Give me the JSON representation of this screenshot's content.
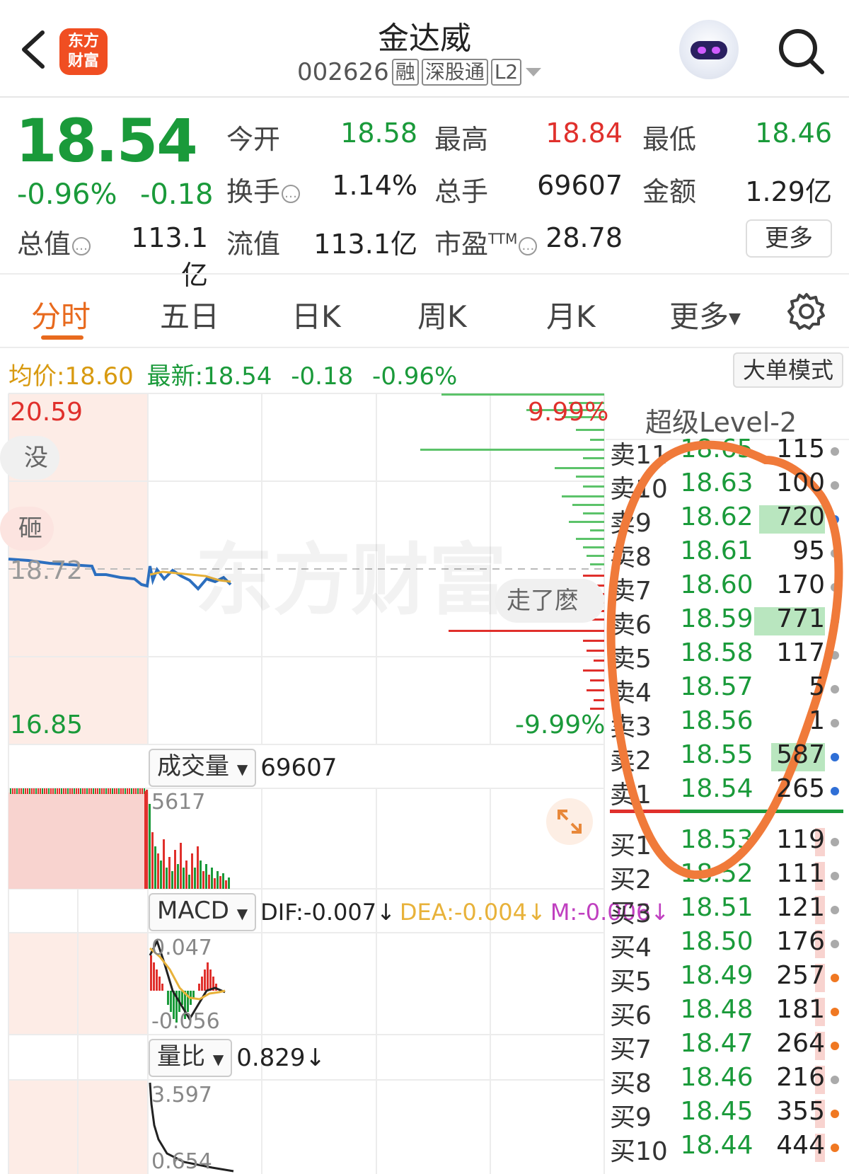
{
  "header": {
    "title": "金达威",
    "code": "002626",
    "tags": [
      "融",
      "深股通",
      "L2"
    ],
    "logo_text": [
      "东方",
      "财富"
    ]
  },
  "quote": {
    "price": "18.54",
    "change_pct": "-0.96%",
    "change": "-0.18",
    "open_label": "今开",
    "open": "18.58",
    "high_label": "最高",
    "high": "18.84",
    "low_label": "最低",
    "low": "18.46",
    "turnover_label": "换手",
    "turnover": "1.14%",
    "volume_label": "总手",
    "volume": "69607",
    "amount_label": "金额",
    "amount": "1.29亿",
    "mktcap_label": "总值",
    "mktcap": "113.1亿",
    "float_label": "流值",
    "float": "113.1亿",
    "pe_label": "市盈",
    "pe_sup": "TTM",
    "pe": "28.78",
    "more_label": "更多"
  },
  "tabs": [
    "分时",
    "五日",
    "日K",
    "周K",
    "月K",
    "更多"
  ],
  "info_line": {
    "avg_label": "均价:",
    "avg": "18.60",
    "latest_label": "最新:",
    "latest": "18.54",
    "chg": "-0.18",
    "pct": "-0.96%",
    "mode_button": "大单模式"
  },
  "intraday": {
    "high_price": "20.59",
    "low_price": "16.85",
    "high_pct": "9.99%",
    "low_pct": "-9.99%",
    "prev_close": "18.72",
    "watermark": "东方财富",
    "bubble_1": "没了",
    "bubble_2": "砸",
    "bubble_3": "走了麽"
  },
  "volume_panel": {
    "label": "成交量",
    "value": "69607",
    "max": "5617"
  },
  "macd_panel": {
    "label": "MACD",
    "dif": "DIF:-0.007↓",
    "dea": "DEA:-0.004↓",
    "m": "M:-0.006↓",
    "top": "0.047",
    "bottom": "-0.056"
  },
  "ratio_panel": {
    "label": "量比",
    "value": "0.829↓",
    "top": "3.597",
    "bottom": "0.654"
  },
  "orderbook": {
    "title": "超级Level-2",
    "asks": [
      {
        "name": "卖11",
        "price": "18.65",
        "vol": "115",
        "bar": 0.0,
        "dot": "gray"
      },
      {
        "name": "卖10",
        "price": "18.63",
        "vol": "100",
        "bar": 0.0,
        "dot": "gray"
      },
      {
        "name": "卖9",
        "price": "18.62",
        "vol": "720",
        "bar": 0.93,
        "dot": "blue"
      },
      {
        "name": "卖8",
        "price": "18.61",
        "vol": "95",
        "bar": 0.0,
        "dot": "gray"
      },
      {
        "name": "卖7",
        "price": "18.60",
        "vol": "170",
        "bar": 0.0,
        "dot": "gray"
      },
      {
        "name": "卖6",
        "price": "18.59",
        "vol": "771",
        "bar": 1.0,
        "dot": "blue"
      },
      {
        "name": "卖5",
        "price": "18.58",
        "vol": "117",
        "bar": 0.0,
        "dot": "gray"
      },
      {
        "name": "卖4",
        "price": "18.57",
        "vol": "5",
        "bar": 0.0,
        "dot": "gray"
      },
      {
        "name": "卖3",
        "price": "18.56",
        "vol": "1",
        "bar": 0.0,
        "dot": "gray"
      },
      {
        "name": "卖2",
        "price": "18.55",
        "vol": "587",
        "bar": 0.76,
        "dot": "blue"
      },
      {
        "name": "卖1",
        "price": "18.54",
        "vol": "265",
        "bar": 0.0,
        "dot": "blue"
      }
    ],
    "bids": [
      {
        "name": "买1",
        "price": "18.53",
        "vol": "119",
        "bar": 0.03,
        "dot": "gray"
      },
      {
        "name": "买2",
        "price": "18.52",
        "vol": "111",
        "bar": 0.03,
        "dot": "gray"
      },
      {
        "name": "买3",
        "price": "18.51",
        "vol": "121",
        "bar": 0.03,
        "dot": "gray"
      },
      {
        "name": "买4",
        "price": "18.50",
        "vol": "176",
        "bar": 0.03,
        "dot": "gray"
      },
      {
        "name": "买5",
        "price": "18.49",
        "vol": "257",
        "bar": 0.03,
        "dot": "orange"
      },
      {
        "name": "买6",
        "price": "18.48",
        "vol": "181",
        "bar": 0.03,
        "dot": "orange"
      },
      {
        "name": "买7",
        "price": "18.47",
        "vol": "264",
        "bar": 0.03,
        "dot": "orange"
      },
      {
        "name": "买8",
        "price": "18.46",
        "vol": "216",
        "bar": 0.03,
        "dot": "gray"
      },
      {
        "name": "买9",
        "price": "18.45",
        "vol": "355",
        "bar": 0.03,
        "dot": "orange"
      },
      {
        "name": "买10",
        "price": "18.44",
        "vol": "444",
        "bar": 0.03,
        "dot": "orange"
      }
    ]
  },
  "colors": {
    "up": "#e0302c",
    "down": "#1a9a3a",
    "accent": "#e86a1e",
    "annotation": "#f07a3a"
  }
}
